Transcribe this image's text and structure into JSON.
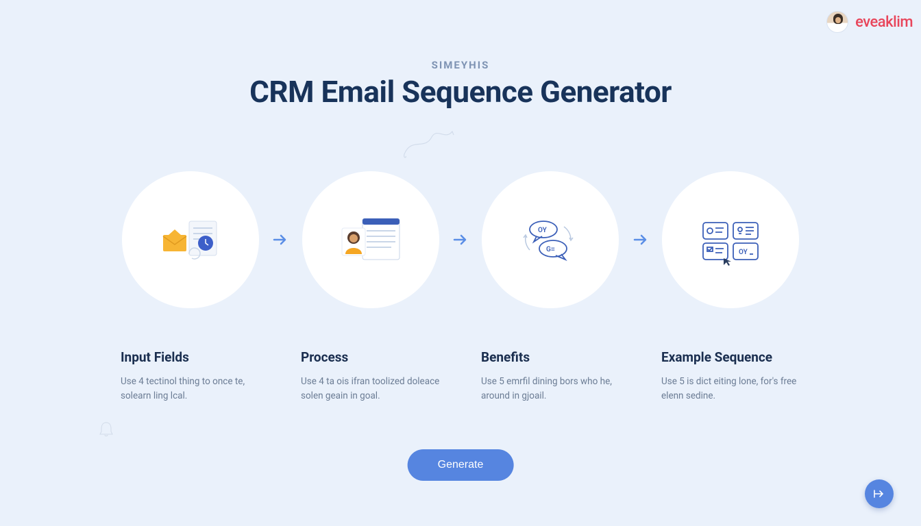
{
  "brand": "eveaklim",
  "eyebrow": "SIMEYHIS",
  "title": "CRM Email Sequence Generator",
  "steps": [
    {
      "title": "Input Fields",
      "desc": "Use 4 tectinol thing to once te, solearn ling lcal."
    },
    {
      "title": "Process",
      "desc": "Use 4 ta ois ifran toolized doleace solen geain in goal."
    },
    {
      "title": "Benefits",
      "desc": "Use 5 emrfil dining bors who he, around in gjoail."
    },
    {
      "title": "Example Sequence",
      "desc": "Use 5 is dict eiting lone, for's free elenn sedine."
    }
  ],
  "generateLabel": "Generate",
  "colors": {
    "accent": "#5685e0",
    "brand": "#e8455a",
    "heading": "#18335a"
  }
}
